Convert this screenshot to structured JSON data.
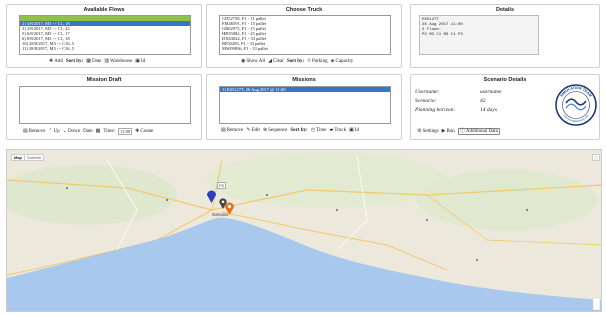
{
  "available_flows": {
    "title": "Available Flows",
    "items": [
      "",
      "2) 4/8/2017, M3 -> C1, 18",
      "3) 3/8/2017, M3 -> C1, 22",
      "5) 6/8/2017, M3 -> C1, 17",
      "6) 8/8/2017, M3 -> C1, 18",
      "10) 28/8/2017, M3 -> C16, 5",
      "11) 28/8/2017, M3 -> C16, 5"
    ],
    "selected_index": 1,
    "toolbar": {
      "add": "Add",
      "sort_by": "Sort by:",
      "date": "Date",
      "warehouse": "Warehouse",
      "id": "Id"
    }
  },
  "choose_truck": {
    "title": "Choose Truck",
    "items": [
      "CD52758, F1 - 11 pallet",
      "FM46591, F1 - 15 pallet",
      "GR02975, F1 - 15 pallet",
      "HR35082, F1 - 25 pallet",
      "DX63042, F1 - 33 pallet",
      "RF02285, F1 - 33 pallet",
      "MW09836, F1 - 33 pallet"
    ],
    "toolbar": {
      "show_all": "Show All",
      "clear": "Clear",
      "sort_by": "Sort by:",
      "parking": "Parking",
      "capacity": "Capacity"
    }
  },
  "details": {
    "title": "Details",
    "text": "ES5127T\n26 Aug 2017 11:00\n2 Flows:\nP3 M3 C1 M3 C1 P3"
  },
  "mission_draft": {
    "title": "Mission Draft",
    "toolbar": {
      "remove": "Remove",
      "up": "Up",
      "down": "Down",
      "date": "Date",
      "time_label": "Time:",
      "time_value": "11:00",
      "create": "Create"
    }
  },
  "missions": {
    "title": "Missions",
    "items": [
      "1) ES5127T, 26 Aug 2017 @ 11:00"
    ],
    "toolbar": {
      "remove": "Remove",
      "edit": "Edit",
      "sequence": "Sequence",
      "sort_by": "Sort by:",
      "time": "Time",
      "truck": "Truck",
      "id": "Id"
    }
  },
  "scenario_details": {
    "title": "Scenario Details",
    "username_label": "Username:",
    "username_value": "username",
    "scenario_label": "Scenario:",
    "scenario_value": "42",
    "horizon_label": "Planning horizon:",
    "horizon_value": "14 days",
    "logo_text": "SIMULATION TEAM",
    "logo_url": "www.simulationteam.com",
    "toolbar": {
      "settings": "Settings",
      "run": "Run",
      "additional": "Additional Data"
    }
  },
  "map": {
    "map_tab": "Map",
    "satellite_tab": "Satellite",
    "city_label": "Genova",
    "pin_label": "P3"
  },
  "colors": {
    "selection": "#3a75c4",
    "green_row": "#8fc04a",
    "sea": "#a9c8ee",
    "land": "#ede8dc"
  }
}
